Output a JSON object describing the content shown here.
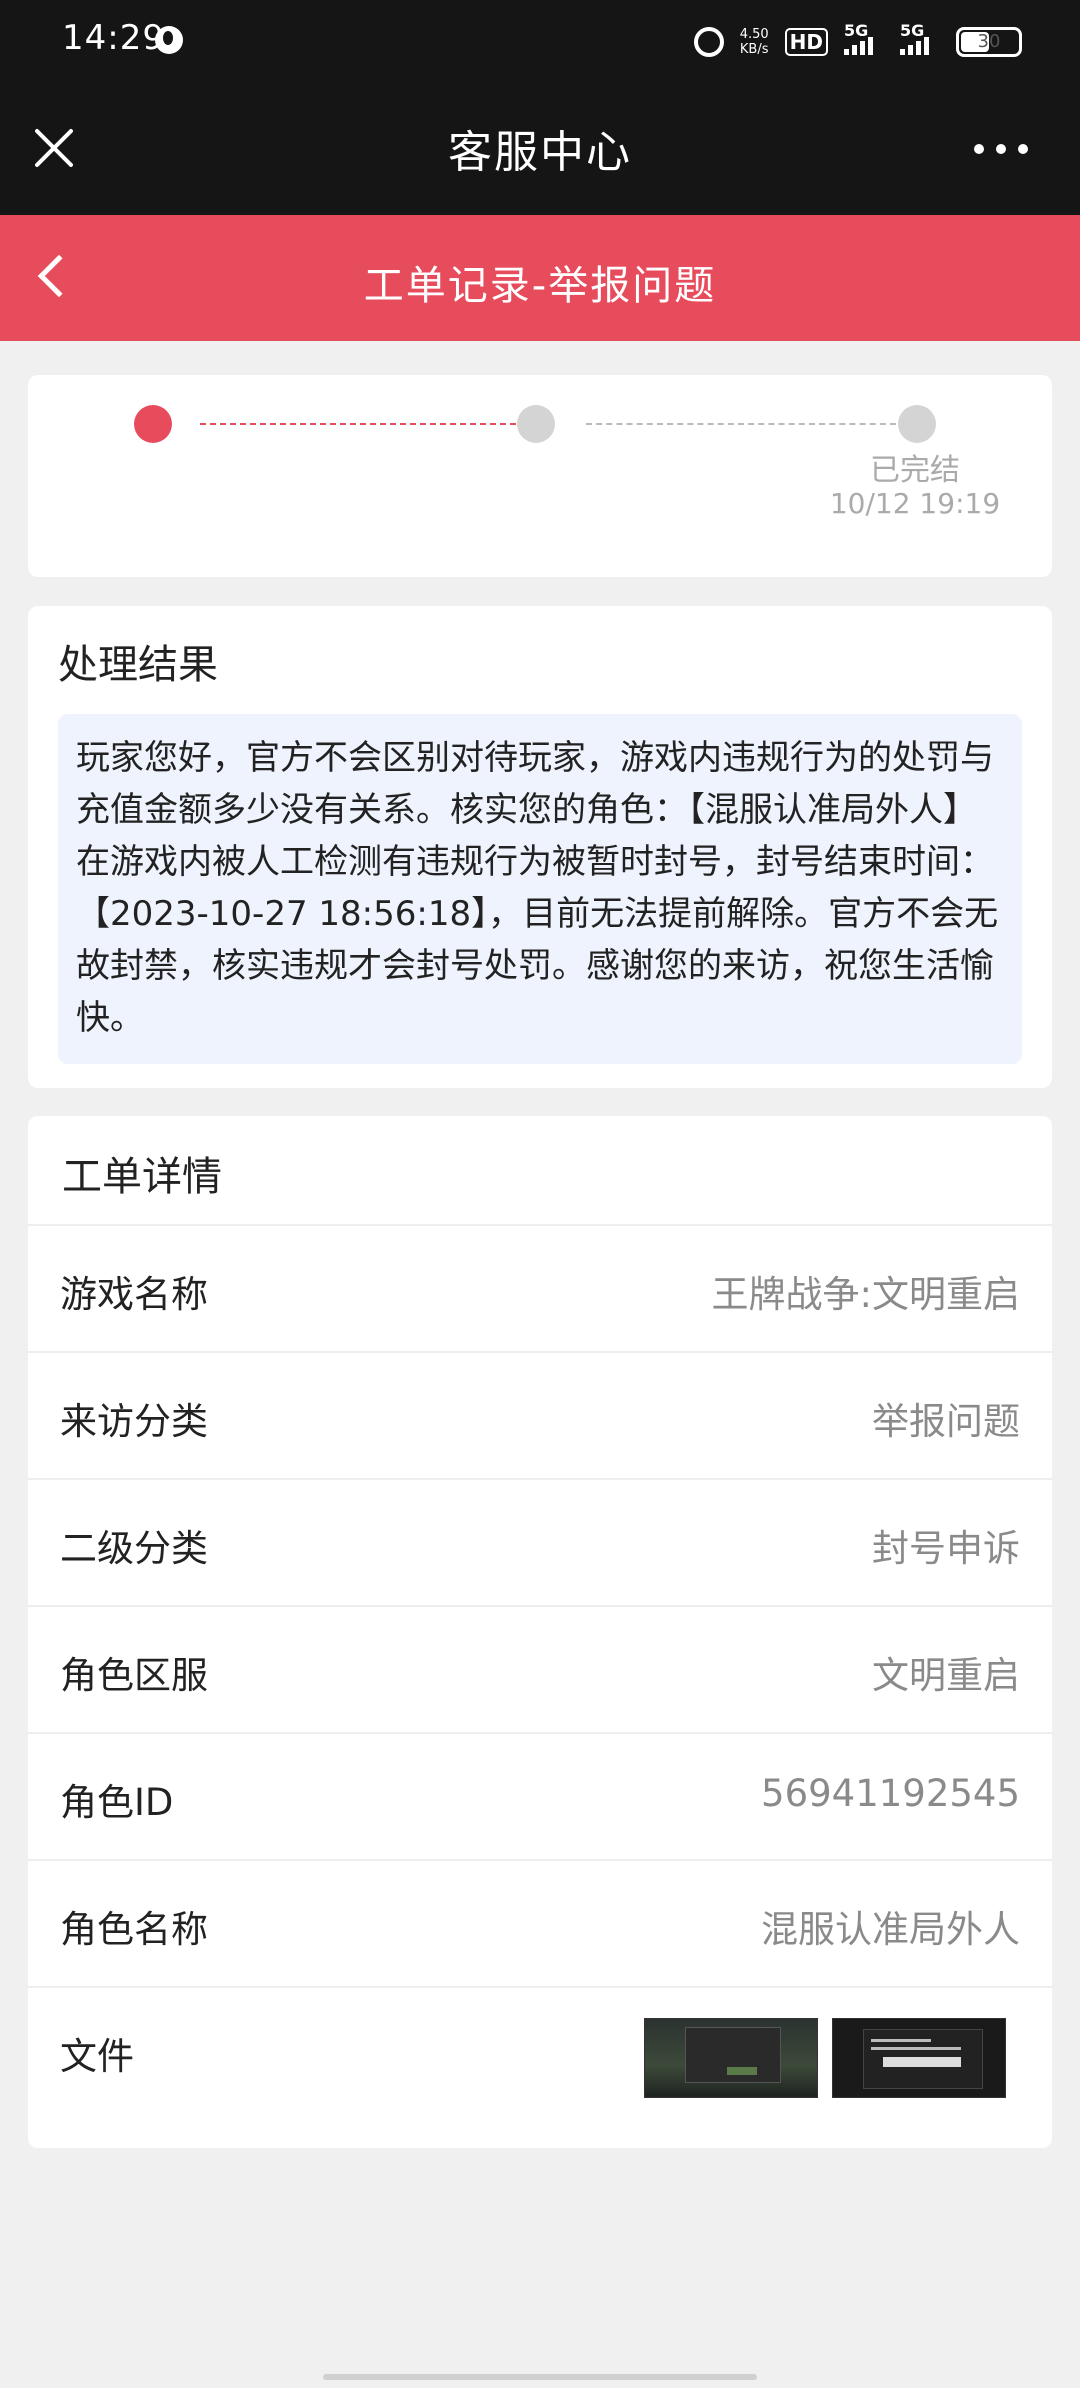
{
  "status_bar": {
    "time": "14:29",
    "net_speed_value": "4.50",
    "net_speed_unit": "KB/s",
    "hd_label": "HD",
    "sim1_label": "5G",
    "sim2_label": "5G",
    "battery": "30"
  },
  "title_bar": {
    "title": "客服中心"
  },
  "header": {
    "title": "工单记录-举报问题"
  },
  "progress": {
    "steps_total": 3,
    "current_step": 1,
    "final_label": "已完结",
    "final_time": "10/12 19:19"
  },
  "result": {
    "title": "处理结果",
    "text": "玩家您好，官方不会区别对待玩家，游戏内违规行为的处罚与充值金额多少没有关系。核实您的角色：【混服认准局外人】在游戏内被人工检测有违规行为被暂时封号，封号结束时间：【2023-10-27 18:56:18】，目前无法提前解除。官方不会无故封禁，核实违规才会封号处罚。感谢您的来访，祝您生活愉快。"
  },
  "details": {
    "title": "工单详情",
    "rows": [
      {
        "label": "游戏名称",
        "value": "王牌战争:文明重启"
      },
      {
        "label": "来访分类",
        "value": "举报问题"
      },
      {
        "label": "二级分类",
        "value": "封号申诉"
      },
      {
        "label": "角色区服",
        "value": "文明重启"
      },
      {
        "label": "角色ID",
        "value": "56941192545"
      },
      {
        "label": "角色名称",
        "value": "混服认准局外人"
      }
    ],
    "file_label": "文件"
  },
  "colors": {
    "accent": "#e74c5d",
    "dark_bar": "#151515",
    "result_bg": "#eef3fd"
  }
}
